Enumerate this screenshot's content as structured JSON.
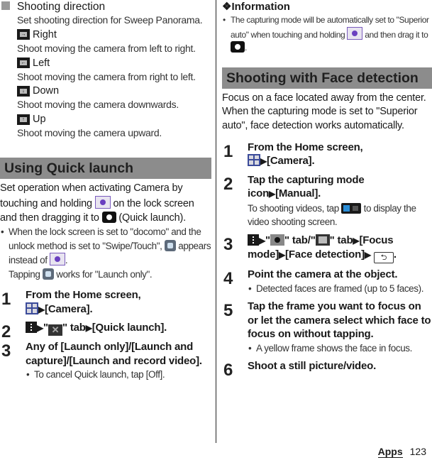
{
  "left": {
    "shooting_direction": {
      "heading": "Shooting direction",
      "description": "Set shooting direction for Sweep Panorama.",
      "options": [
        {
          "icon": "arrow-right-icon",
          "glyph": "→",
          "label": "Right",
          "desc": "Shoot moving the camera from left to right."
        },
        {
          "icon": "arrow-left-icon",
          "glyph": "←",
          "label": "Left",
          "desc": "Shoot moving the camera from right to left."
        },
        {
          "icon": "arrow-down-icon",
          "glyph": "↓",
          "label": "Down",
          "desc": "Shoot moving the camera downwards."
        },
        {
          "icon": "arrow-up-icon",
          "glyph": "↑",
          "label": "Up",
          "desc": "Shoot moving the camera upward."
        }
      ]
    },
    "quick_launch": {
      "title": "Using Quick launch",
      "intro_1": "Set operation when activating Camera by touching and holding",
      "intro_2": "on the lock screen and then dragging it to",
      "intro_3": "(Quick launch).",
      "bullet_1": "When the lock screen is set to \"docomo\" and the unlock method is set to \"Swipe/Touch\",",
      "bullet_2": "appears instead of",
      "bullet_3": ".",
      "bullet_4": "Tapping",
      "bullet_5": "works for \"Launch only\".",
      "steps": [
        {
          "num": "1",
          "text_a": "From the Home screen,",
          "text_b": "[Camera]."
        },
        {
          "num": "2",
          "text_a": "\"",
          "text_b": "\" tab",
          "text_c": "[Quick launch]."
        },
        {
          "num": "3",
          "text": "Any of [Launch only]/[Launch and capture]/[Launch and record video].",
          "sub": "To cancel Quick launch, tap [Off]."
        }
      ]
    }
  },
  "right": {
    "information": {
      "heading": "Information",
      "marker": "❖",
      "bullet_a": "The capturing mode will be automatically set to \"Superior auto\" when touching and holding",
      "bullet_b": "and then drag it to",
      "bullet_c": "."
    },
    "face_detection": {
      "title": "Shooting with Face detection",
      "intro": "Focus on a face located away from the center. When the capturing mode is set to \"Superior auto\", face detection works automatically.",
      "steps": [
        {
          "num": "1",
          "text_a": "From the Home screen,",
          "text_b": "[Camera]."
        },
        {
          "num": "2",
          "text": "Tap the capturing mode icon",
          "text_b": "[Manual].",
          "sub_a": "To shooting videos, tap",
          "sub_b": "to display the video shooting screen."
        },
        {
          "num": "3",
          "text_a": "\"",
          "text_b": "\" tab/\"",
          "text_c": "\" tab",
          "text_d": "[Focus mode]",
          "text_e": "[Face detection]",
          "text_f": "."
        },
        {
          "num": "4",
          "text": "Point the camera at the object.",
          "sub": "Detected faces are framed (up to 5 faces)."
        },
        {
          "num": "5",
          "text": "Tap the frame you want to focus on or let the camera select which face to focus on without tapping.",
          "sub": "A yellow frame shows the face in focus."
        },
        {
          "num": "6",
          "text": "Shoot a still picture/video."
        }
      ]
    }
  },
  "footer": {
    "section": "Apps",
    "page": "123"
  },
  "symbols": {
    "arrow": "▶",
    "back": "⮌",
    "tools": "✕"
  }
}
